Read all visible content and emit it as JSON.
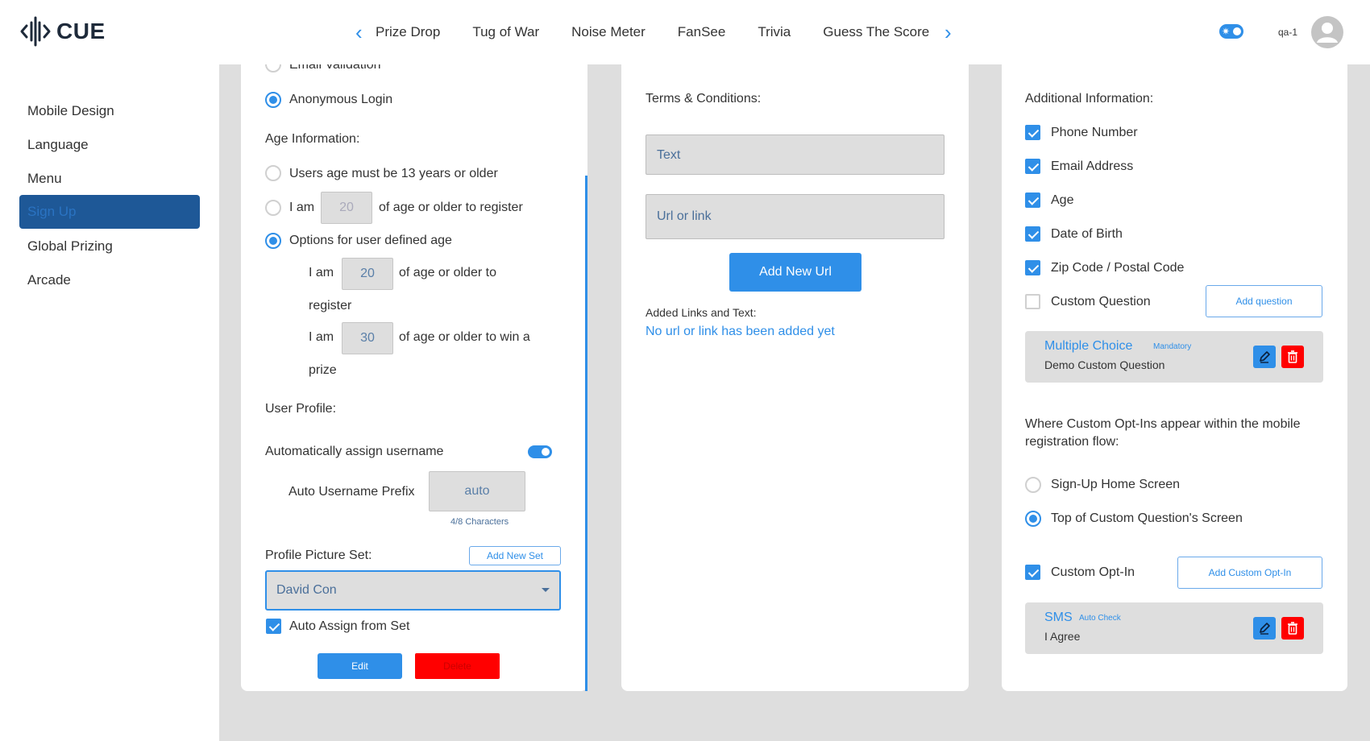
{
  "header": {
    "logo_text": "CUE",
    "tabs": [
      "Prize Drop",
      "Tug of War",
      "Noise Meter",
      "FanSee",
      "Trivia",
      "Guess The Score"
    ],
    "prev_arrow": "‹",
    "next_arrow": "›",
    "user_name": "qa-1"
  },
  "sidebar": {
    "items": [
      "Mobile Design",
      "Language",
      "Menu",
      "Sign Up",
      "Global Prizing",
      "Arcade"
    ],
    "active": "Sign Up"
  },
  "panel_left": {
    "email_validation": "Email Validation",
    "anonymous_login": "Anonymous Login",
    "age_heading": "Age Information:",
    "age_opt1": "Users age must be 13 years or older",
    "age_opt2_pre": "I am",
    "age_opt2_value": "20",
    "age_opt2_post": "of age or older to register",
    "age_opt3": "Options for user defined age",
    "reg_pre": "I am",
    "reg_value": "20",
    "reg_post": "of age or older to",
    "reg_post2": "register",
    "prize_pre": "I am",
    "prize_value": "30",
    "prize_post": "of age or older to win a",
    "prize_post2": "prize",
    "profile_heading": "User Profile:",
    "auto_username": "Automatically assign username",
    "prefix_label": "Auto Username Prefix",
    "prefix_value": "auto",
    "prefix_count": "4/8 Characters",
    "pic_set_label": "Profile Picture Set:",
    "add_new_set": "Add New Set",
    "pic_set_value": "David Con",
    "auto_assign": "Auto Assign from Set",
    "edit": "Edit",
    "delete": "Delete"
  },
  "panel_mid": {
    "terms_heading": "Terms & Conditions:",
    "text_placeholder": "Text",
    "url_placeholder": "Url or link",
    "add_url": "Add New Url",
    "added_heading": "Added Links and Text:",
    "empty_message": "No url or link has been added yet"
  },
  "panel_right": {
    "heading": "Additional Information:",
    "fields": [
      {
        "label": "Phone Number",
        "checked": true
      },
      {
        "label": "Email Address",
        "checked": true
      },
      {
        "label": "Age",
        "checked": true
      },
      {
        "label": "Date of Birth",
        "checked": true
      },
      {
        "label": "Zip Code / Postal Code",
        "checked": true
      },
      {
        "label": "Custom Question",
        "checked": false
      }
    ],
    "add_question": "Add question",
    "question_card": {
      "title": "Multiple Choice",
      "tag": "Mandatory",
      "subtitle": "Demo Custom Question"
    },
    "optin_heading": "Where Custom Opt-Ins appear within the mobile registration flow:",
    "optin_opt1": "Sign-Up Home Screen",
    "optin_opt2": "Top of Custom Question's Screen",
    "custom_optin": "Custom Opt-In",
    "add_optin": "Add Custom Opt-In",
    "optin_card": {
      "title": "SMS",
      "tag": "Auto Check",
      "subtitle": "I Agree"
    }
  },
  "colors": {
    "accent": "#2f8fe8",
    "danger": "#ff0000",
    "active_nav": "#1e5897"
  }
}
